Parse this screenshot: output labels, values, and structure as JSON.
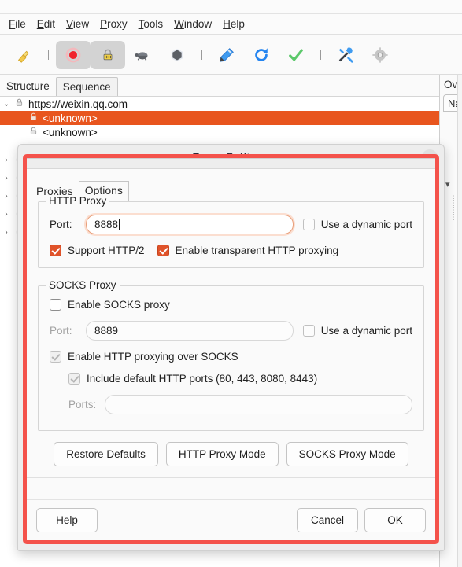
{
  "menubar": {
    "items": [
      {
        "mnemonic": "F",
        "rest": "ile"
      },
      {
        "mnemonic": "E",
        "rest": "dit"
      },
      {
        "mnemonic": "V",
        "rest": "iew"
      },
      {
        "mnemonic": "P",
        "rest": "roxy"
      },
      {
        "mnemonic": "T",
        "rest": "ools"
      },
      {
        "mnemonic": "W",
        "rest": "indow"
      },
      {
        "mnemonic": "H",
        "rest": "elp"
      }
    ]
  },
  "toolbar": {
    "buttons": [
      {
        "name": "clear-session-icon",
        "glyph": "🧹",
        "pressed": false
      },
      {
        "name": "separator",
        "glyph": "",
        "pressed": false
      },
      {
        "name": "record-icon",
        "glyph": "⬤",
        "pressed": true
      },
      {
        "name": "ssl-proxying-icon",
        "glyph": "🔒",
        "pressed": true
      },
      {
        "name": "throttle-turtle-icon",
        "glyph": "🐢",
        "pressed": false
      },
      {
        "name": "breakpoint-hexagon-icon",
        "glyph": "⬢",
        "pressed": false
      },
      {
        "name": "separator",
        "glyph": "",
        "pressed": false
      },
      {
        "name": "compose-pen-icon",
        "glyph": "🖊",
        "pressed": false
      },
      {
        "name": "repeat-refresh-icon",
        "glyph": "↻",
        "pressed": false
      },
      {
        "name": "validate-check-icon",
        "glyph": "✔",
        "pressed": false
      },
      {
        "name": "separator",
        "glyph": "",
        "pressed": false
      },
      {
        "name": "tools-icon",
        "glyph": "🛠",
        "pressed": false
      },
      {
        "name": "settings-gear-icon",
        "glyph": "⚙",
        "pressed": false
      }
    ]
  },
  "view_tabs": [
    {
      "label": "Structure",
      "active": true
    },
    {
      "label": "Sequence",
      "active": false
    }
  ],
  "tree": {
    "rows": [
      {
        "indent": 0,
        "chevron": "⌄",
        "lock": true,
        "label": "https://weixin.qq.com",
        "selected": false
      },
      {
        "indent": 1,
        "chevron": "",
        "lock": true,
        "label": "<unknown>",
        "selected": true
      },
      {
        "indent": 1,
        "chevron": "",
        "lock": true,
        "label": "<unknown>",
        "selected": false
      },
      {
        "indent": 0,
        "chevron": "›",
        "lock": true,
        "label": "",
        "selected": false
      },
      {
        "indent": 0,
        "chevron": "›",
        "lock": true,
        "label": "",
        "selected": false
      },
      {
        "indent": 0,
        "chevron": "›",
        "lock": true,
        "label": "",
        "selected": false
      },
      {
        "indent": 0,
        "chevron": "›",
        "lock": true,
        "label": "",
        "selected": false
      },
      {
        "indent": 0,
        "chevron": "›",
        "lock": true,
        "label": "",
        "selected": false
      }
    ]
  },
  "right_panel": {
    "title": "Ov",
    "column_header": "Na"
  },
  "dialog": {
    "title": "Proxy Settings",
    "close_glyph": "✕",
    "tabs": [
      {
        "label": "Proxies",
        "active": true
      },
      {
        "label": "Options",
        "active": false
      }
    ],
    "http_proxy": {
      "legend": "HTTP Proxy",
      "port_label": "Port:",
      "port_value": "8888",
      "dynamic_port_label": "Use a dynamic port",
      "dynamic_port_checked": false,
      "support_http2_label": "Support HTTP/2",
      "support_http2_checked": true,
      "transparent_label": "Enable transparent HTTP proxying",
      "transparent_checked": true
    },
    "socks_proxy": {
      "legend": "SOCKS Proxy",
      "enable_label": "Enable SOCKS proxy",
      "enable_checked": false,
      "port_label": "Port:",
      "port_value": "8889",
      "dynamic_port_label": "Use a dynamic port",
      "dynamic_port_checked": false,
      "http_over_socks_label": "Enable HTTP proxying over SOCKS",
      "http_over_socks_checked": true,
      "include_default_label": "Include default HTTP ports (80, 443, 8080, 8443)",
      "include_default_checked": true,
      "ports_label": "Ports:",
      "ports_value": ""
    },
    "mode_buttons": [
      {
        "label": "Restore Defaults"
      },
      {
        "label": "HTTP Proxy Mode"
      },
      {
        "label": "SOCKS Proxy Mode"
      }
    ],
    "footer": {
      "help_label": "Help",
      "cancel_label": "Cancel",
      "ok_label": "OK"
    }
  },
  "colors": {
    "highlight_red": "#f4524b",
    "selection_orange": "#e8551e",
    "checkbox_checked": "#e0532a",
    "focus_ring": "#e8a07c"
  }
}
